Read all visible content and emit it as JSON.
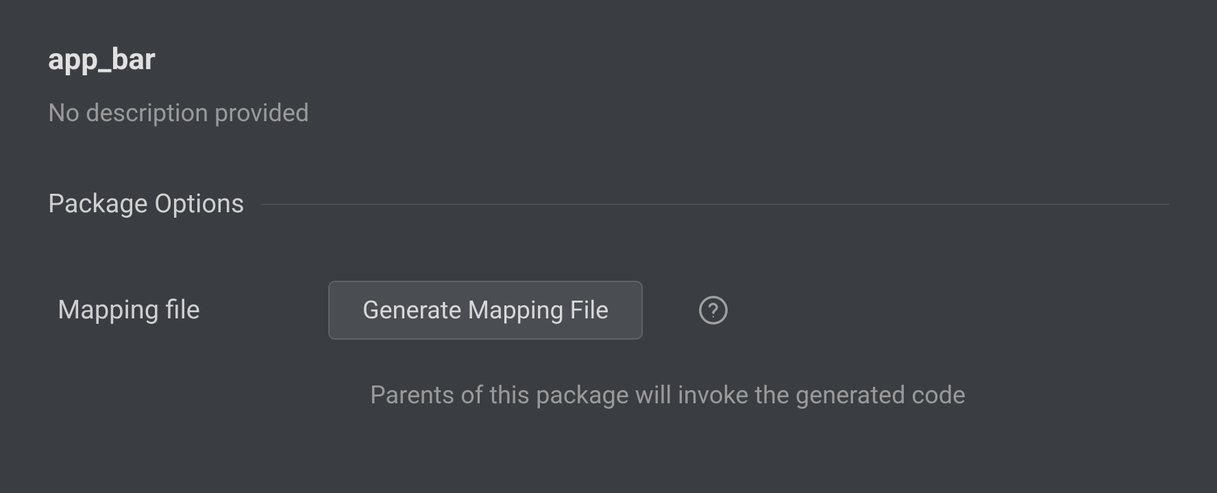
{
  "package": {
    "title": "app_bar",
    "description": "No description provided"
  },
  "section": {
    "title": "Package Options"
  },
  "options": {
    "mapping_file": {
      "label": "Mapping file",
      "button_label": "Generate Mapping File",
      "helper_text": "Parents of this package will invoke the generated code"
    }
  }
}
